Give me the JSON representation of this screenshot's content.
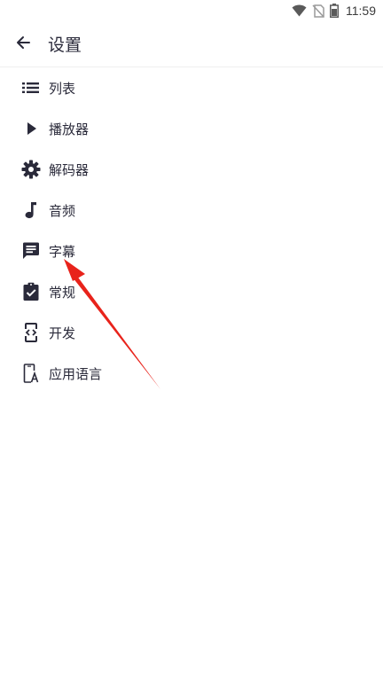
{
  "status_bar": {
    "time": "11:59",
    "icons": [
      "wifi-icon",
      "no-sim-icon",
      "battery-icon"
    ]
  },
  "header": {
    "back_icon": "arrow-left-icon",
    "title": "设置"
  },
  "menu": {
    "items": [
      {
        "label": "列表",
        "icon": "list-icon"
      },
      {
        "label": "播放器",
        "icon": "play-icon"
      },
      {
        "label": "解码器",
        "icon": "gear-icon"
      },
      {
        "label": "音频",
        "icon": "music-note-icon"
      },
      {
        "label": "字幕",
        "icon": "subtitle-icon"
      },
      {
        "label": "常规",
        "icon": "clipboard-check-icon"
      },
      {
        "label": "开发",
        "icon": "developer-icon"
      },
      {
        "label": "应用语言",
        "icon": "app-language-icon"
      }
    ]
  },
  "colors": {
    "icon": "#2a2a3a",
    "annotation_arrow": "#e8231b"
  }
}
